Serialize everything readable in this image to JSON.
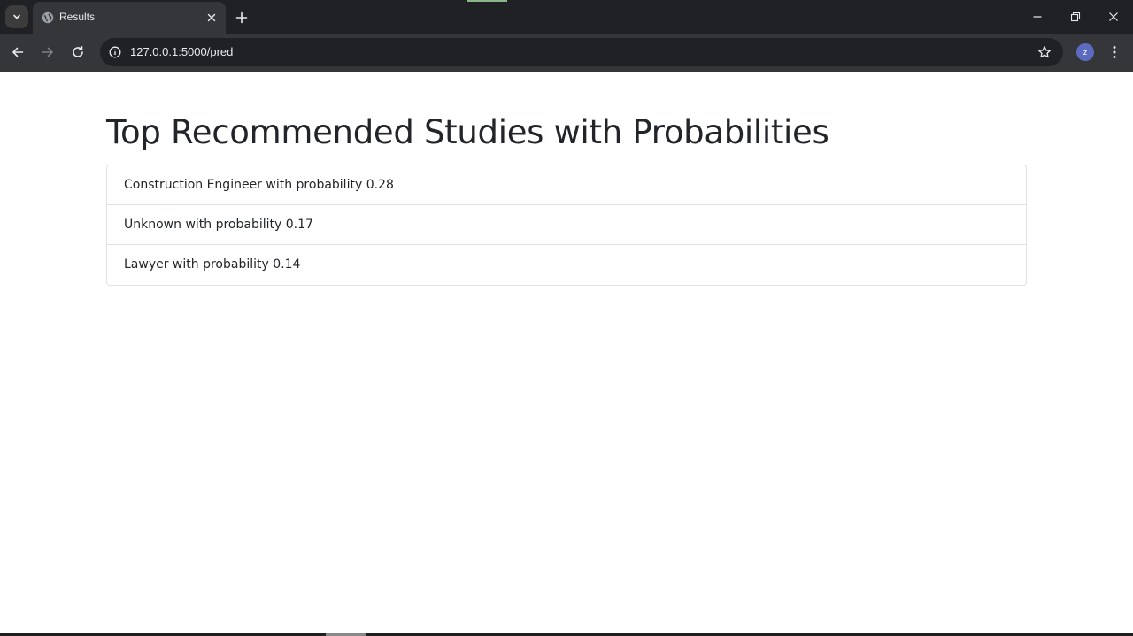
{
  "browser": {
    "tab_title": "Results",
    "url": "127.0.0.1:5000/pred",
    "profile_initial": "z",
    "icons": {
      "tab_search": "chevron-down-icon",
      "favicon": "globe-icon",
      "tab_close": "close-icon",
      "new_tab": "plus-icon",
      "minimize": "minimize-icon",
      "restore": "restore-icon",
      "close_window": "close-icon",
      "back": "arrow-left-icon",
      "forward": "arrow-right-icon",
      "reload": "reload-icon",
      "site_info": "info-icon",
      "bookmark": "star-icon",
      "menu": "kebab-menu-icon"
    },
    "colors": {
      "tabstrip": "#202124",
      "toolbar": "#35363a",
      "omnibox": "#202124",
      "avatar": "#5c6bc0"
    }
  },
  "page": {
    "title": "Top Recommended Studies with Probabilities",
    "results": [
      {
        "text": "Construction Engineer with probability 0.28"
      },
      {
        "text": "Unknown with probability 0.17"
      },
      {
        "text": "Lawyer with probability 0.14"
      }
    ]
  }
}
